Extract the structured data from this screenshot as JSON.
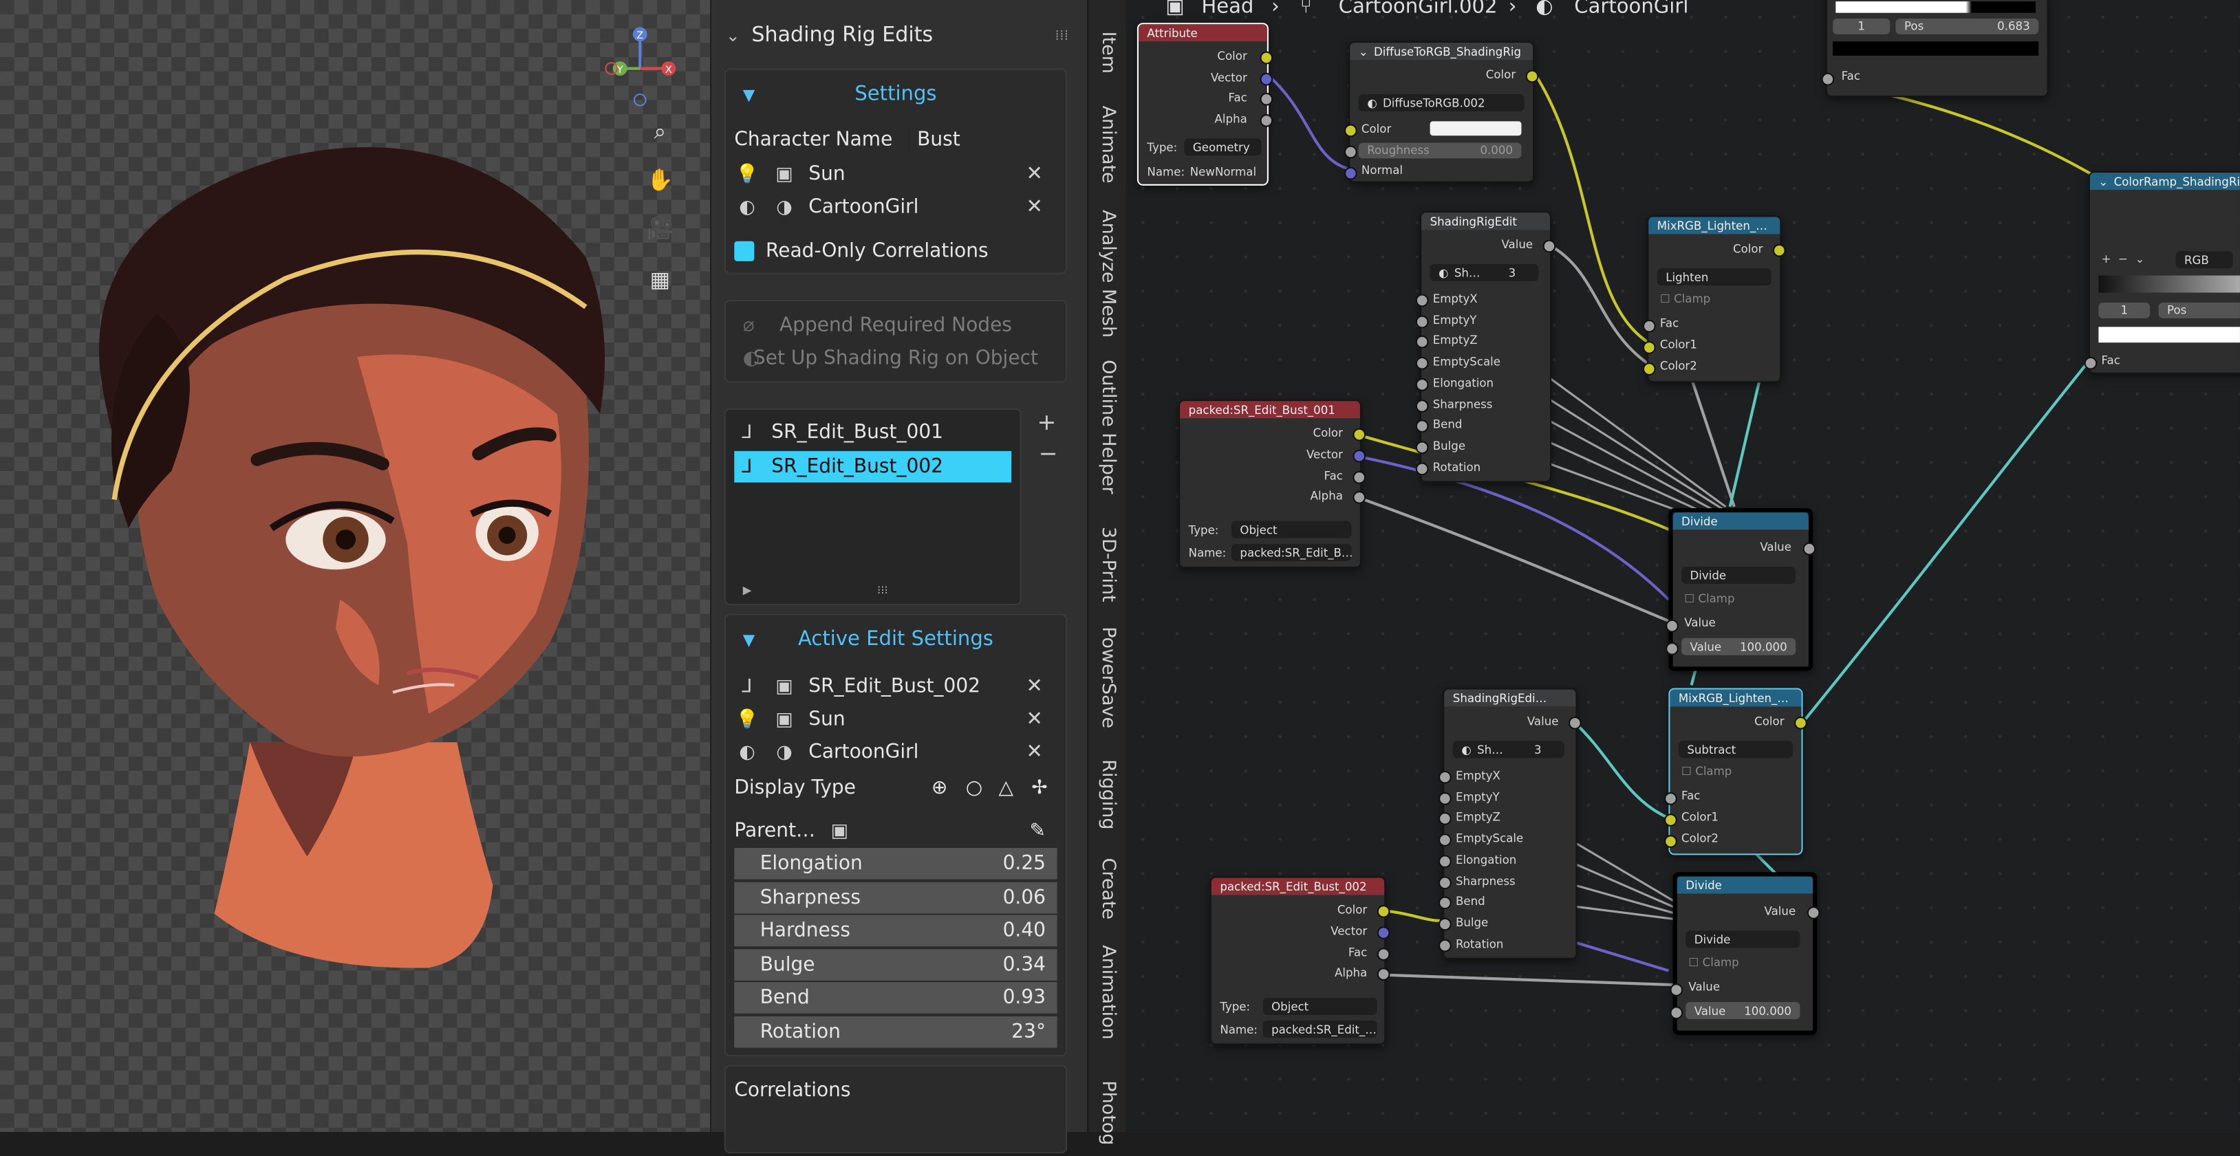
{
  "viewport": {
    "axis_labels": {
      "z": "Z",
      "y": "Y",
      "x": "X"
    },
    "tool_icons": [
      "zoom-icon",
      "hand-icon",
      "camera-icon",
      "grid-icon"
    ]
  },
  "npanel": {
    "title": "Shading Rig Edits",
    "settings": {
      "header": "Settings",
      "character_name_label": "Character Name",
      "character_name_value": "Bust",
      "light_object": "Sun",
      "material": "CartoonGirl",
      "readonly_label": "Read-Only Correlations"
    },
    "buttons": {
      "append": "Append Required Nodes",
      "setup": "Set Up Shading Rig on Object"
    },
    "edits_list": [
      "SR_Edit_Bust_001",
      "SR_Edit_Bust_002"
    ],
    "selected_edit_index": 1,
    "active_edit": {
      "header": "Active Edit Settings",
      "edit_name": "SR_Edit_Bust_002",
      "light_object": "Sun",
      "material": "CartoonGirl",
      "display_type_label": "Display Type",
      "parent_label": "Parent…"
    },
    "sliders": [
      {
        "label": "Elongation",
        "value": "0.25"
      },
      {
        "label": "Sharpness",
        "value": "0.06"
      },
      {
        "label": "Hardness",
        "value": "0.40"
      },
      {
        "label": "Bulge",
        "value": "0.34"
      },
      {
        "label": "Bend",
        "value": "0.93"
      },
      {
        "label": "Rotation",
        "value": "23°"
      }
    ],
    "correlations_label": "Correlations"
  },
  "tabs": [
    "Item",
    "Animate",
    "Analyze Mesh",
    "Outline Helper",
    "3D-Print",
    "PowerSave",
    "Rigging",
    "Create",
    "Animation",
    "Photog"
  ],
  "breadcrumb": {
    "object": "Head",
    "mesh": "CartoonGirl.002",
    "material": "CartoonGirl"
  },
  "nodes": {
    "attribute": {
      "title": "Attribute",
      "outputs": [
        "Color",
        "Vector",
        "Fac",
        "Alpha"
      ],
      "type_label": "Type:",
      "type_value": "Geometry",
      "name_label": "Name:",
      "name_value": "NewNormal"
    },
    "diffuse": {
      "title": "DiffuseToRGB_ShadingRig",
      "output": "Color",
      "datablock": "DiffuseToRGB.002",
      "inputs": [
        "Color",
        "Roughness",
        "Normal"
      ],
      "roughness_value": "0.000"
    },
    "sre1": {
      "title": "ShadingRigEdit",
      "output": "Value",
      "datablock": "Sh…",
      "users": "3",
      "inputs": [
        "EmptyX",
        "EmptyY",
        "EmptyZ",
        "EmptyScale",
        "Elongation",
        "Sharpness",
        "Bend",
        "Bulge",
        "Rotation"
      ]
    },
    "sre2": {
      "title": "ShadingRigEdi…",
      "output": "Value",
      "datablock": "Sh…",
      "users": "3",
      "inputs": [
        "EmptyX",
        "EmptyY",
        "EmptyZ",
        "EmptyScale",
        "Elongation",
        "Sharpness",
        "Bend",
        "Bulge",
        "Rotation"
      ]
    },
    "packed1": {
      "title": "packed:SR_Edit_Bust_001",
      "outputs": [
        "Color",
        "Vector",
        "Fac",
        "Alpha"
      ],
      "type_label": "Type:",
      "type_value": "Object",
      "name_label": "Name:",
      "name_value": "packed:SR_Edit_B…"
    },
    "packed2": {
      "title": "packed:SR_Edit_Bust_002",
      "outputs": [
        "Color",
        "Vector",
        "Fac",
        "Alpha"
      ],
      "type_label": "Type:",
      "type_value": "Object",
      "name_label": "Name:",
      "name_value": "packed:SR_Edit_…"
    },
    "mix1": {
      "title": "MixRGB_Lighten_…",
      "output": "Color",
      "mode": "Lighten",
      "clamp": "Clamp",
      "inputs": [
        "Fac",
        "Color1",
        "Color2"
      ]
    },
    "mix2": {
      "title": "MixRGB_Lighten_…",
      "output": "Color",
      "mode": "Subtract",
      "clamp": "Clamp",
      "inputs": [
        "Fac",
        "Color1",
        "Color2"
      ]
    },
    "divide1": {
      "title": "Divide",
      "output": "Value",
      "mode": "Divide",
      "clamp": "Clamp",
      "input": "Value",
      "value_label": "Value",
      "value": "100.000"
    },
    "divide2": {
      "title": "Divide",
      "output": "Value",
      "mode": "Divide",
      "clamp": "Clamp",
      "input": "Value",
      "value_label": "Value",
      "value": "100.000"
    },
    "ramp_top": {
      "stop": "1",
      "pos_label": "Pos",
      "pos": "0.683",
      "output": "Fac"
    },
    "ramp_right": {
      "title": "ColorRamp_ShadingRig",
      "mode": "RGB",
      "stop": "1",
      "pos_label": "Pos",
      "input": "Fac"
    }
  },
  "colors": {
    "accent": "#4fc3f7",
    "selected_item": "#3ad0f8",
    "header_red": "#8b2d34",
    "header_blue": "#246283",
    "socket_yellow": "#c7c729",
    "socket_purple": "#6363c7"
  }
}
